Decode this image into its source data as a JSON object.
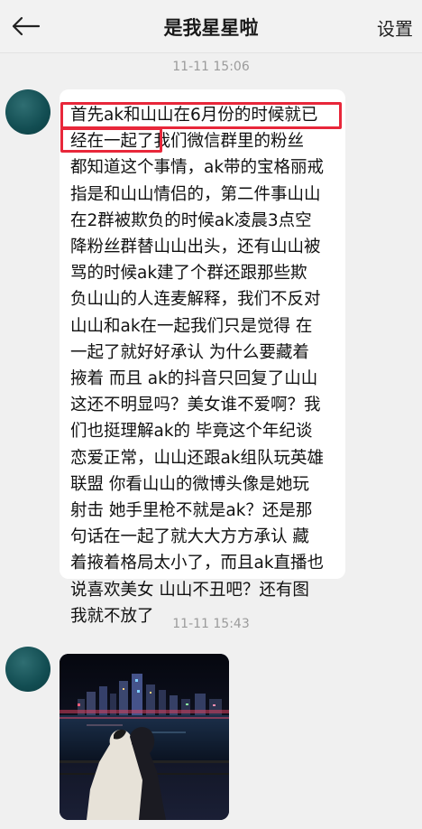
{
  "header": {
    "title": "是我星星啦",
    "settings_label": "设置",
    "back_icon": "arrow-left-icon"
  },
  "messages": [
    {
      "timestamp": "11-11 15:06",
      "type": "text",
      "text": "首先ak和山山在6月份的时候就已\n经在一起了我们微信群里的粉丝\n都知道这个事情，ak带的宝格丽戒\n指是和山山情侣的，第二件事山山\n在2群被欺负的时候ak凌晨3点空\n降粉丝群替山山出头，还有山山被\n骂的时候ak建了个群还跟那些欺\n负山山的人连麦解释，我们不反对\n山山和ak在一起我们只是觉得 在\n一起了就好好承认 为什么要藏着\n掖着 而且 ak的抖音只回复了山山\n这还不明显吗？美女谁不爱啊？我\n们也挺理解ak的 毕竟这个年纪谈\n恋爱正常，山山还跟ak组队玩英雄\n联盟 你看山山的微博头像是她玩\n射击 她手里枪不就是ak？还是那\n句话在一起了就大大方方承认 藏\n着掖着格局太小了，而且ak直播也\n说喜欢美女 山山不丑吧？还有图\n我就不放了"
    },
    {
      "timestamp": "11-11 15:43",
      "type": "image"
    }
  ],
  "colors": {
    "highlight": "#e8273a",
    "background": "#f0f0f0",
    "bubble": "#ffffff",
    "timestamp": "#9b9b9b"
  }
}
